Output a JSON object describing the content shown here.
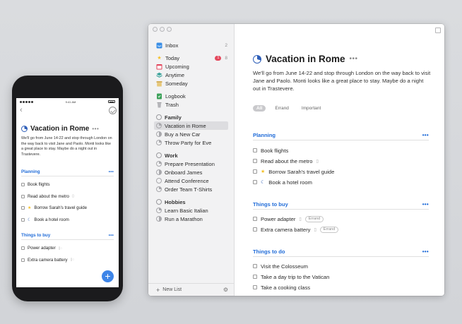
{
  "phone": {
    "status_time": "9:41 AM",
    "back_icon": "chevron-left-icon",
    "done_icon": "check-circle-icon",
    "project_title": "Vacation in Rome",
    "more": "•••",
    "notes": "We'll go from June 14-22 and stop through London on the way back to visit Jane and Paolo. Monti looks like a great place to stay. Maybe do a night out in Trastevere.",
    "headings": [
      {
        "label": "Planning",
        "todos": [
          {
            "title": "Book flights",
            "icon": ""
          },
          {
            "title": "Read about the metro",
            "icon": "note-icon"
          },
          {
            "title": "Borrow Sarah's travel guide",
            "icon": "star-icon"
          },
          {
            "title": "Book a hotel room",
            "icon": "moon-icon"
          }
        ]
      },
      {
        "label": "Things to buy",
        "todos": [
          {
            "title": "Power adapter",
            "icon": "note-icon"
          },
          {
            "title": "Extra camera battery",
            "icon": "note-icon"
          }
        ]
      }
    ],
    "fab": "+"
  },
  "mac": {
    "sidebar": {
      "inbox": {
        "label": "Inbox",
        "count": "2",
        "icon": "inbox-icon",
        "color": "#3a8ee6"
      },
      "today": {
        "label": "Today",
        "badge": "1",
        "count": "8",
        "icon": "star-icon",
        "color": "#f4c028",
        "badge_color": "#e4485c"
      },
      "upcoming": {
        "label": "Upcoming",
        "icon": "calendar-icon",
        "color": "#e2435a"
      },
      "anytime": {
        "label": "Anytime",
        "icon": "layers-icon",
        "color": "#3aa39a"
      },
      "someday": {
        "label": "Someday",
        "icon": "archive-box-icon",
        "color": "#d6b05a"
      },
      "logbook": {
        "label": "Logbook",
        "icon": "logbook-icon",
        "color": "#3da25a"
      },
      "trash": {
        "label": "Trash",
        "icon": "trash-icon",
        "color": "#9a9a9e"
      },
      "areas": [
        {
          "label": "Family",
          "projects": [
            "Vacation in Rome",
            "Buy a New Car",
            "Throw Party for Eve"
          ]
        },
        {
          "label": "Work",
          "projects": [
            "Prepare Presentation",
            "Onboard James",
            "Attend Conference",
            "Order Team T-Shirts"
          ]
        },
        {
          "label": "Hobbies",
          "projects": [
            "Learn Basic Italian",
            "Run a Marathon"
          ]
        }
      ],
      "new_list": "New List",
      "settings_icon": "sliders-icon"
    },
    "main": {
      "title": "Vacation in Rome",
      "more": "•••",
      "notes": "We'll go from June 14-22 and stop through London on the way back to visit Jane and Paolo. Monti looks like a great place to stay. Maybe do a night out in Trastevere.",
      "tags": [
        "All",
        "Errand",
        "Important"
      ],
      "headings": [
        {
          "label": "Planning",
          "todos": [
            "Book flights",
            "Read about the metro",
            "Borrow Sarah's travel guide",
            "Book a hotel room"
          ]
        },
        {
          "label": "Things to buy",
          "todos": [
            "Power adapter",
            "Extra camera battery"
          ],
          "tag": "Errand"
        },
        {
          "label": "Things to do",
          "todos": [
            "Visit the Colosseum",
            "Take a day trip to the Vatican",
            "Take a cooking class"
          ]
        }
      ]
    }
  }
}
